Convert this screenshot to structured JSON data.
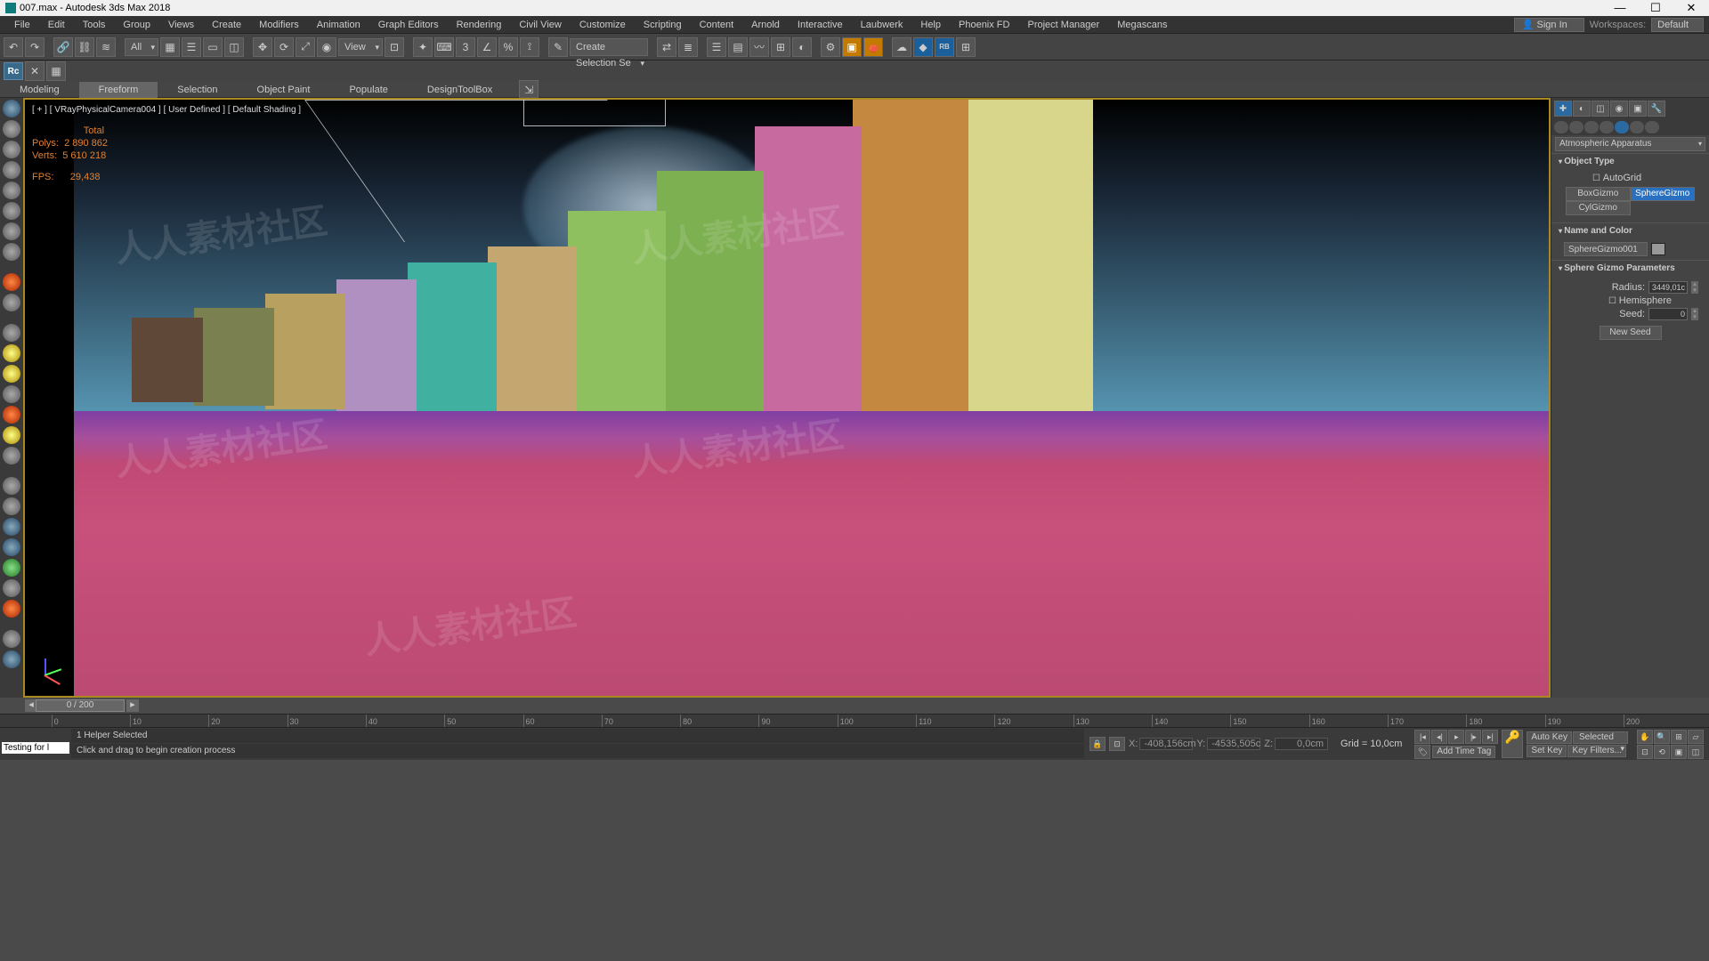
{
  "title": "007.max - Autodesk 3ds Max 2018",
  "menu": [
    "File",
    "Edit",
    "Tools",
    "Group",
    "Views",
    "Create",
    "Modifiers",
    "Animation",
    "Graph Editors",
    "Rendering",
    "Civil View",
    "Customize",
    "Scripting",
    "Content",
    "Arnold",
    "Interactive",
    "Laubwerk",
    "Help",
    "Phoenix FD",
    "Project Manager",
    "Megascans"
  ],
  "signin": "Sign In",
  "workspaces_label": "Workspaces:",
  "workspaces_value": "Default",
  "toolbar": {
    "all": "All",
    "view": "View",
    "selset": "Create Selection Se"
  },
  "ribbon": [
    "Modeling",
    "Freeform",
    "Selection",
    "Object Paint",
    "Populate",
    "DesignToolBox"
  ],
  "ribbon_active": 1,
  "viewport": {
    "label": "[ + ] [ VRayPhysicalCamera004 ] [ User Defined ] [ Default Shading ]",
    "stats": {
      "total": "Total",
      "polys": "Polys:",
      "polys_v": "2 890 862",
      "verts": "Verts:",
      "verts_v": "5 610 218",
      "fps": "FPS:",
      "fps_v": "29,438"
    }
  },
  "right": {
    "dropdown": "Atmospheric Apparatus",
    "object_type": "Object Type",
    "autogrid": "AutoGrid",
    "btns": [
      "BoxGizmo",
      "SphereGizmo",
      "CylGizmo"
    ],
    "btn_sel": 1,
    "name_color": "Name and Color",
    "name_val": "SphereGizmo001",
    "params": "Sphere Gizmo Parameters",
    "radius": "Radius:",
    "radius_v": "3449,01c",
    "hemi": "Hemisphere",
    "seed": "Seed:",
    "seed_v": "0",
    "newseed": "New Seed"
  },
  "timeslider": "0 / 200",
  "timeline_ticks": [
    "0",
    "10",
    "20",
    "30",
    "40",
    "50",
    "60",
    "70",
    "80",
    "90",
    "100",
    "110",
    "120",
    "130",
    "140",
    "150",
    "160",
    "170",
    "180",
    "190",
    "200"
  ],
  "status": {
    "testing": "Testing for l",
    "sel": "1 Helper Selected",
    "hint": "Click and drag to begin creation process",
    "x_lbl": "X:",
    "x": "-408,156cm",
    "y_lbl": "Y:",
    "y": "-4535,505c",
    "z_lbl": "Z:",
    "z": "0,0cm",
    "grid": "Grid = 10,0cm",
    "addtag": "Add Time Tag",
    "autokey": "Auto Key",
    "selected": "Selected",
    "setkey": "Set Key",
    "keyfilt": "Key Filters..."
  }
}
